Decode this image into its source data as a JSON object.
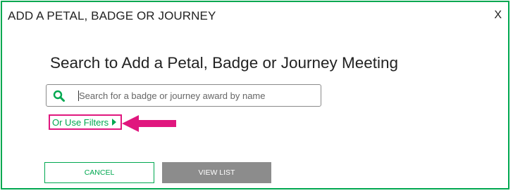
{
  "modal": {
    "title": "ADD A PETAL, BADGE OR JOURNEY",
    "close_label": "X",
    "heading": "Search to Add a Petal, Badge or Journey Meeting"
  },
  "search": {
    "placeholder": "Search for a badge or journey award by name",
    "value": "",
    "icon": "search-icon"
  },
  "filters": {
    "label": "Or Use Filters",
    "icon": "triangle-right-icon"
  },
  "annotation": {
    "icon": "arrow-left-icon",
    "color": "#e0177e"
  },
  "buttons": {
    "cancel": "CANCEL",
    "view_list": "VIEW LIST"
  },
  "colors": {
    "accent": "#00a850",
    "highlight": "#e0177e",
    "disabled_button": "#8c8c8c"
  }
}
